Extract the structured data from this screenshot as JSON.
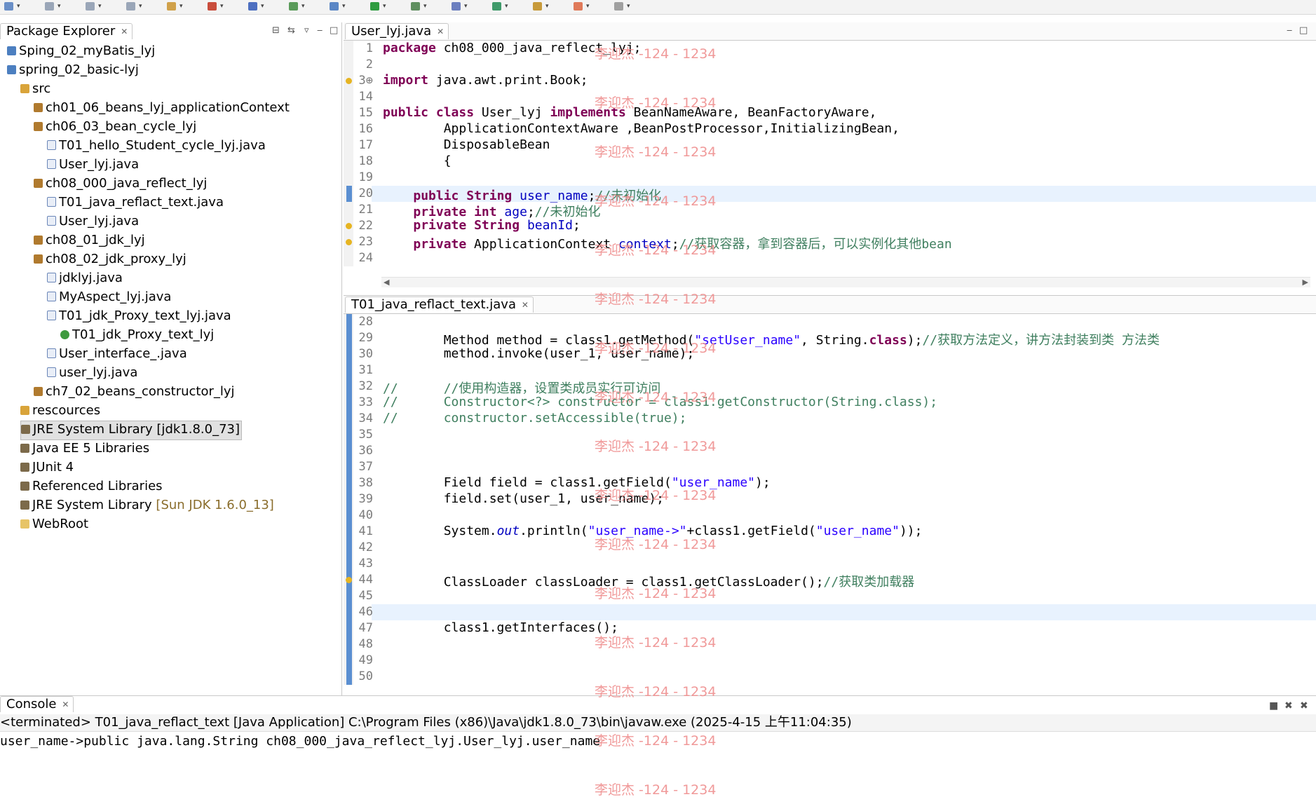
{
  "toolbar": {
    "icons": [
      "new-icon",
      "save-icon",
      "save-all-icon",
      "print-icon",
      "new-wizard-icon",
      "build-icon",
      "server-icon",
      "web-icon",
      "search-icon",
      "run-icon",
      "debug-icon",
      "profile-icon",
      "external-tools-icon",
      "back-icon",
      "forward-icon",
      "pin-icon"
    ]
  },
  "package_explorer": {
    "tab_label": "Package Explorer",
    "tree": [
      {
        "label": "Sping_02_myBatis_lyj",
        "icon": "project-icon",
        "indent": 0
      },
      {
        "label": "spring_02_basic-lyj",
        "icon": "project-icon",
        "indent": 0
      },
      {
        "label": "src",
        "icon": "source-folder-icon",
        "indent": 1
      },
      {
        "label": "ch01_06_beans_lyj_applicationContext",
        "icon": "package-icon",
        "indent": 2
      },
      {
        "label": "ch06_03_bean_cycle_lyj",
        "icon": "package-icon",
        "indent": 2
      },
      {
        "label": "T01_hello_Student_cycle_lyj.java",
        "icon": "java-file-icon",
        "indent": 3
      },
      {
        "label": "User_lyj.java",
        "icon": "java-file-icon",
        "indent": 3
      },
      {
        "label": "ch08_000_java_reflect_lyj",
        "icon": "package-icon",
        "indent": 2
      },
      {
        "label": "T01_java_reflact_text.java",
        "icon": "java-file-icon",
        "indent": 3
      },
      {
        "label": "User_lyj.java",
        "icon": "java-file-icon",
        "indent": 3
      },
      {
        "label": "ch08_01_jdk_lyj",
        "icon": "package-icon",
        "indent": 2
      },
      {
        "label": "ch08_02_jdk_proxy_lyj",
        "icon": "package-icon",
        "indent": 2
      },
      {
        "label": "jdklyj.java",
        "icon": "java-file-icon",
        "indent": 3
      },
      {
        "label": "MyAspect_lyj.java",
        "icon": "java-file-icon",
        "indent": 3
      },
      {
        "label": "T01_jdk_Proxy_text_lyj.java",
        "icon": "java-file-icon",
        "indent": 3
      },
      {
        "label": "T01_jdk_Proxy_text_lyj",
        "icon": "class-icon",
        "indent": 4
      },
      {
        "label": "User_interface_.java",
        "icon": "java-file-icon",
        "indent": 3
      },
      {
        "label": "user_lyj.java",
        "icon": "java-file-icon",
        "indent": 3
      },
      {
        "label": "ch7_02_beans_constructor_lyj",
        "icon": "package-icon",
        "indent": 2
      },
      {
        "label": "rescources",
        "icon": "source-folder-icon",
        "indent": 1
      },
      {
        "label": "JRE System Library [jdk1.8.0_73]",
        "icon": "library-icon",
        "indent": 1,
        "selected": true
      },
      {
        "label": "Java EE 5 Libraries",
        "icon": "library-icon",
        "indent": 1
      },
      {
        "label": "JUnit 4",
        "icon": "library-icon",
        "indent": 1
      },
      {
        "label": "Referenced Libraries",
        "icon": "library-icon",
        "indent": 1
      },
      {
        "label": "JRE System Library",
        "suffix": "[Sun JDK 1.6.0_13]",
        "icon": "library-icon",
        "indent": 1
      },
      {
        "label": "WebRoot",
        "icon": "folder-icon",
        "indent": 1
      }
    ]
  },
  "editor_top": {
    "tab_label": "User_lyj.java",
    "lines": [
      {
        "n": "1",
        "code": "package ch08_000_java_reflect_lyj;"
      },
      {
        "n": "2",
        "code": ""
      },
      {
        "n": "3⊕",
        "code": "import java.awt.print.Book;"
      },
      {
        "n": "14",
        "code": ""
      },
      {
        "n": "15",
        "code": "public class User_lyj implements BeanNameAware, BeanFactoryAware,"
      },
      {
        "n": "16",
        "code": "        ApplicationContextAware ,BeanPostProcessor,InitializingBean,"
      },
      {
        "n": "17",
        "code": "        DisposableBean"
      },
      {
        "n": "18",
        "code": "        {"
      },
      {
        "n": "19",
        "code": ""
      },
      {
        "n": "20",
        "code": "    public String user_name;//未初始化"
      },
      {
        "n": "21",
        "code": "    private int age;//未初始化"
      },
      {
        "n": "22",
        "code": "    private String beanId;"
      },
      {
        "n": "23",
        "code": "    private ApplicationContext context;//获取容器，拿到容器后，可以实例化其他bean"
      },
      {
        "n": "24",
        "code": ""
      }
    ]
  },
  "editor_bottom": {
    "tab_label": "T01_java_reflact_text.java",
    "lines": [
      {
        "n": "28",
        "code": ""
      },
      {
        "n": "29",
        "code": "        Method method = class1.getMethod(\"setUser_name\", String.class);//获取方法定义，讲方法封装到类 方法类"
      },
      {
        "n": "30",
        "code": "        method.invoke(user_1, user_name);"
      },
      {
        "n": "31",
        "code": ""
      },
      {
        "n": "32",
        "code": "//      //使用构造器，设置类成员实行可访问"
      },
      {
        "n": "33",
        "code": "//      Constructor<?> constructor = class1.getConstructor(String.class);"
      },
      {
        "n": "34",
        "code": "//      constructor.setAccessible(true);"
      },
      {
        "n": "35",
        "code": ""
      },
      {
        "n": "36",
        "code": ""
      },
      {
        "n": "37",
        "code": ""
      },
      {
        "n": "38",
        "code": "        Field field = class1.getField(\"user_name\");"
      },
      {
        "n": "39",
        "code": "        field.set(user_1, user_name);"
      },
      {
        "n": "40",
        "code": ""
      },
      {
        "n": "41",
        "code": "        System.out.println(\"user_name->\"+class1.getField(\"user_name\"));"
      },
      {
        "n": "42",
        "code": ""
      },
      {
        "n": "43",
        "code": ""
      },
      {
        "n": "44",
        "code": "        ClassLoader classLoader = class1.getClassLoader();//获取类加载器"
      },
      {
        "n": "45",
        "code": ""
      },
      {
        "n": "46",
        "code": ""
      },
      {
        "n": "47",
        "code": "        class1.getInterfaces();"
      },
      {
        "n": "48",
        "code": ""
      },
      {
        "n": "49",
        "code": ""
      },
      {
        "n": "50",
        "code": ""
      }
    ]
  },
  "console": {
    "tab_label": "Console",
    "status": "<terminated> T01_java_reflact_text [Java Application] C:\\Program Files (x86)\\Java\\jdk1.8.0_73\\bin\\javaw.exe (2025-4-15 上午11:04:35)",
    "output": "user_name->public java.lang.String ch08_000_java_reflect_lyj.User_lyj.user_name"
  },
  "watermark": "李迎杰 -124 - 1234",
  "colors": {
    "keyword": "#7f0055",
    "field": "#0000c0",
    "string": "#2a00ff",
    "comment": "#3f7f5f",
    "watermark": "#ef8f8f"
  }
}
